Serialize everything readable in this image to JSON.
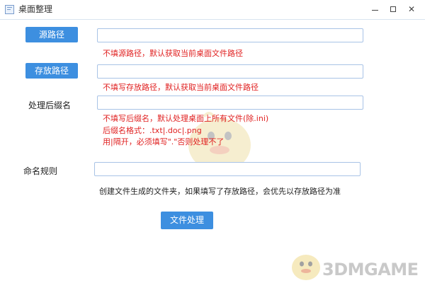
{
  "window": {
    "title": "桌面整理"
  },
  "controls": {
    "minimize_icon": "minimize-icon",
    "maximize_icon": "maximize-icon",
    "close_icon": "close-icon",
    "close_glyph": "✕"
  },
  "source": {
    "button_label": "源路径",
    "value": "",
    "hint": "不填源路径，默认获取当前桌面文件路径"
  },
  "target": {
    "button_label": "存放路径",
    "value": "",
    "hint": "不填写存放路径，默认获取当前桌面文件路径"
  },
  "suffix": {
    "label": "处理后缀名",
    "value": "",
    "hints": [
      "不填写后缀名，默认处理桌面上所有文件(除.ini)",
      "后缀名格式：.txt|.doc|.png",
      "用|隔开，必须填写\".\"否则处理不了"
    ]
  },
  "naming": {
    "label": "命名规则",
    "value": "",
    "note": "创建文件生成的文件夹，如果填写了存放路径，会优先以存放路径为准"
  },
  "process_button": {
    "label": "文件处理"
  },
  "watermark": {
    "brand": "3DMGAME"
  },
  "colors": {
    "accent": "#3d8fe0",
    "hint": "#e02020",
    "input_border": "#a8c3e6"
  }
}
